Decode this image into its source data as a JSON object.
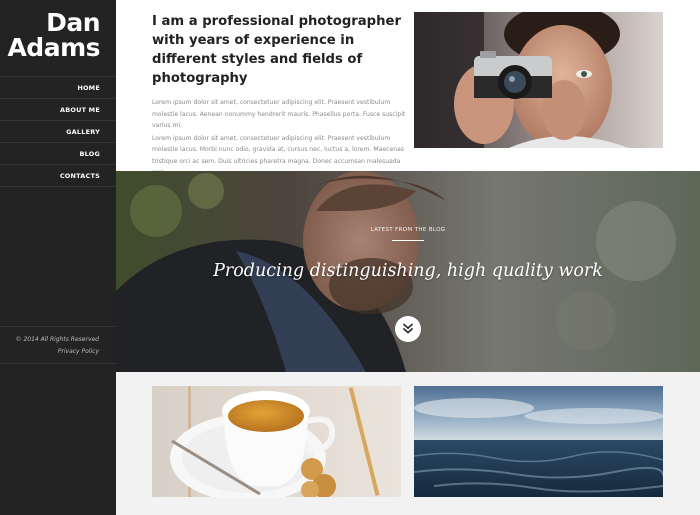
{
  "brand": {
    "line1": "Dan",
    "line2": "Adams"
  },
  "nav": {
    "items": [
      {
        "label": "HOME"
      },
      {
        "label": "ABOUT ME"
      },
      {
        "label": "GALLERY"
      },
      {
        "label": "BLOG"
      },
      {
        "label": "CONTACTS"
      }
    ]
  },
  "sidebar_footer": {
    "copyright": "© 2014 All Rights Reserved",
    "privacy": "Privacy Policy"
  },
  "intro": {
    "heading": "I am a professional photographer with years of experience in different styles and fields of photography",
    "paragraph1": "Lorem ipsum dolor sit amet, consectetuer adipiscing elit. Praesent vestibulum molestie lacus. Aenean nonummy hendrerit mauris. Phasellus porta. Fusce suscipit varius mi.",
    "paragraph2": "Lorem ipsum dolor sit amet, consectetuer adipiscing elit. Praesent vestibulum molestie lacus. Morbi nunc odio, gravida at, cursus nec, luctus a, lorem. Maecenas tristique orci ac sem. Duis ultricies pharetra magna. Donec accumsan malesuada orci."
  },
  "hero": {
    "kicker": "LATEST FROM THE BLOG",
    "title": "Producing distinguishing, high quality work"
  },
  "icons": {
    "scroll_down": "double-chevron-down-icon"
  },
  "colors": {
    "sidebar_bg": "#232323",
    "nav_divider": "#363636",
    "heading_text": "#222222",
    "body_text": "#8a8a8a",
    "bottom_band": "#f2f2f2"
  }
}
